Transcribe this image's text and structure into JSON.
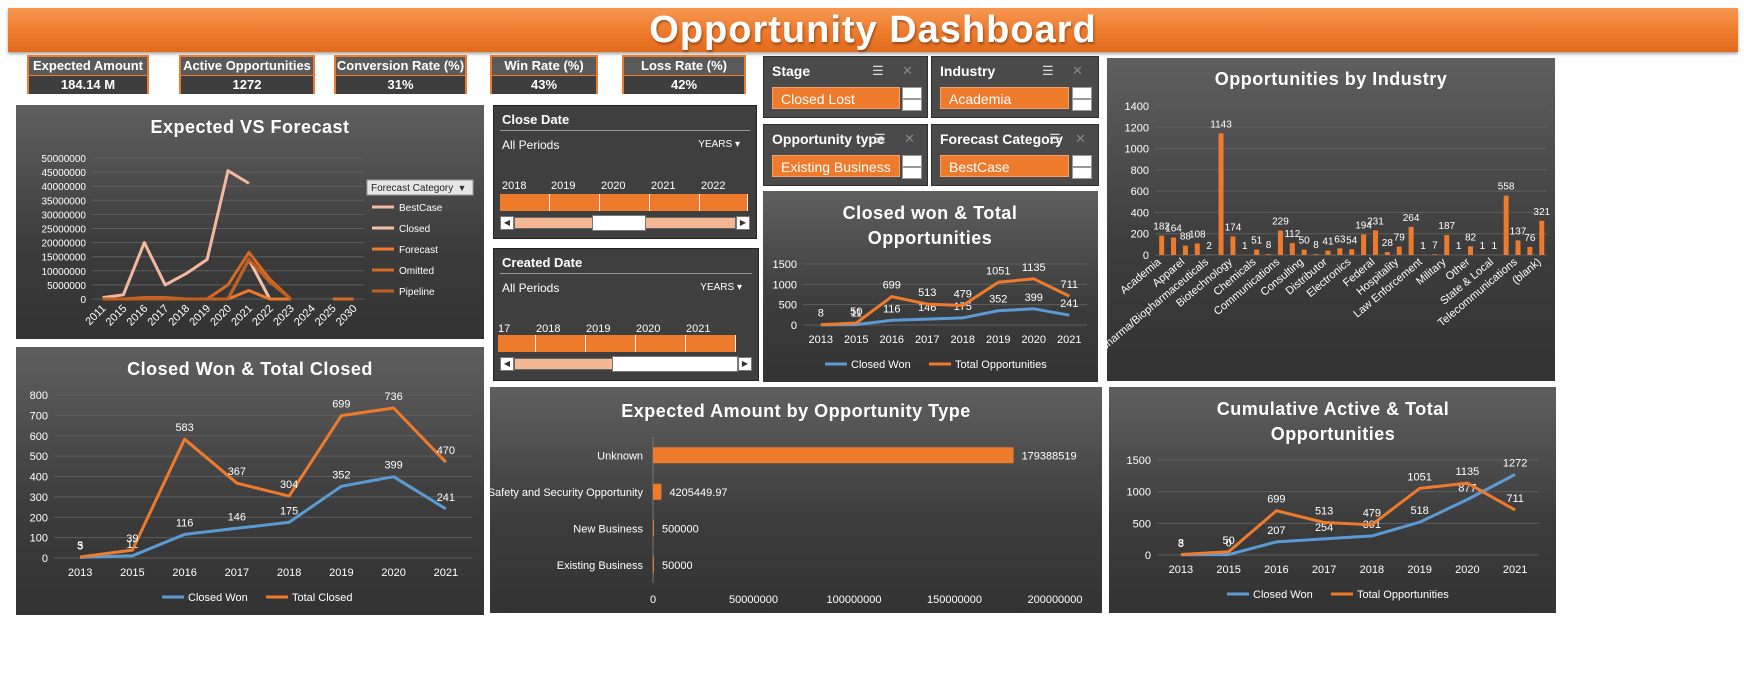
{
  "title": "Opportunity Dashboard",
  "kpis": [
    {
      "label": "Expected Amount",
      "value": "184.14 M"
    },
    {
      "label": "Active Opportunities",
      "value": "1272"
    },
    {
      "label": "Conversion Rate (%)",
      "value": "31%"
    },
    {
      "label": "Win Rate (%)",
      "value": "43%"
    },
    {
      "label": "Loss Rate (%)",
      "value": "42%"
    }
  ],
  "slicers": {
    "stage": {
      "title": "Stage",
      "selected": "Closed Lost"
    },
    "industry": {
      "title": "Industry",
      "selected": "Academia"
    },
    "opp_type": {
      "title": "Opportunity type",
      "selected": "Existing Business"
    },
    "forecast": {
      "title": "Forecast Category",
      "selected": "BestCase"
    }
  },
  "timelines": {
    "close_date": {
      "title": "Close Date",
      "period": "All Periods",
      "level": "YEARS",
      "years": [
        "2018",
        "2019",
        "2020",
        "2021",
        "2022"
      ]
    },
    "created_date": {
      "title": "Created Date",
      "period": "All Periods",
      "level": "YEARS",
      "years": [
        "17",
        "2018",
        "2019",
        "2020",
        "2021"
      ]
    }
  },
  "colors": {
    "orange": "#ee7a2c",
    "blue": "#5b9bd5",
    "accent": "#ee7a2c"
  },
  "chart_data": [
    {
      "id": "expected_vs_forecast",
      "type": "line",
      "title": "Expected VS Forecast",
      "categories": [
        "2011",
        "2015",
        "2016",
        "2017",
        "2018",
        "2019",
        "2020",
        "2021",
        "2022",
        "2023",
        "2024",
        "2025",
        "2030"
      ],
      "ylim": [
        0,
        50000000
      ],
      "yticks": [
        "0",
        "5000000",
        "10000000",
        "15000000",
        "20000000",
        "25000000",
        "30000000",
        "35000000",
        "40000000",
        "45000000",
        "50000000"
      ],
      "legend_title": "Forecast Category",
      "series": [
        {
          "name": "BestCase",
          "color": "#f2b8a0",
          "values": [
            500000,
            1500000,
            20000000,
            5000000,
            9000000,
            14000000,
            45500000,
            41000000,
            null,
            null,
            null,
            null,
            null
          ]
        },
        {
          "name": "Closed",
          "color": "#f4c2a9",
          "values": [
            0,
            0,
            0,
            0,
            0,
            0,
            0,
            14000000,
            0,
            null,
            null,
            null,
            null
          ]
        },
        {
          "name": "Forecast",
          "color": "#ee7a2c",
          "values": [
            0,
            0,
            0,
            0,
            0,
            0,
            0,
            3000000,
            0,
            0,
            null,
            null,
            null
          ]
        },
        {
          "name": "Omitted",
          "color": "#d56a24",
          "values": [
            0,
            0,
            500000,
            500000,
            0,
            0,
            5000000,
            16500000,
            7000000,
            0,
            null,
            0,
            0
          ]
        },
        {
          "name": "Pipeline",
          "color": "#c05f20",
          "values": [
            0,
            0,
            0,
            0,
            0,
            0,
            0,
            14000000,
            6000000,
            0,
            null,
            null,
            null
          ]
        }
      ]
    },
    {
      "id": "closed_won_total_closed",
      "type": "line",
      "title": "Closed Won & Total Closed",
      "categories": [
        "2013",
        "2015",
        "2016",
        "2017",
        "2018",
        "2019",
        "2020",
        "2021"
      ],
      "ylim": [
        0,
        800
      ],
      "yticks": [
        "0",
        "100",
        "200",
        "300",
        "400",
        "500",
        "600",
        "700",
        "800"
      ],
      "series": [
        {
          "name": "Closed Won",
          "color": "#5b9bd5",
          "values": [
            3,
            11,
            116,
            146,
            175,
            352,
            399,
            241
          ],
          "labels": [
            "3",
            "11",
            "116",
            "146",
            "175",
            "352",
            "399",
            "241"
          ]
        },
        {
          "name": "Total Closed",
          "color": "#ee7a2c",
          "values": [
            5,
            39,
            583,
            367,
            304,
            699,
            736,
            470
          ],
          "labels": [
            "5",
            "39",
            "583",
            "367",
            "304",
            "699",
            "736",
            "470"
          ]
        }
      ]
    },
    {
      "id": "closed_won_total_opps",
      "type": "line",
      "title": "Closed won & Total Opportunities",
      "categories": [
        "2013",
        "2015",
        "2016",
        "2017",
        "2018",
        "2019",
        "2020",
        "2021"
      ],
      "ylim": [
        0,
        1500
      ],
      "yticks": [
        "0",
        "500",
        "1000",
        "1500"
      ],
      "series": [
        {
          "name": "Closed Won",
          "color": "#5b9bd5",
          "values": [
            3,
            11,
            116,
            146,
            175,
            352,
            399,
            241
          ],
          "labels": [
            "",
            "11",
            "116",
            "146",
            "175",
            "352",
            "399",
            "241"
          ]
        },
        {
          "name": "Total Opportunities",
          "color": "#ee7a2c",
          "values": [
            8,
            50,
            699,
            513,
            479,
            1051,
            1135,
            711
          ],
          "labels": [
            "8",
            "50",
            "699",
            "513",
            "479",
            "1051",
            "1135",
            "711"
          ]
        }
      ]
    },
    {
      "id": "opps_by_industry",
      "type": "bar",
      "title": "Opportunities by Industry",
      "categories": [
        "Academia",
        "",
        "Apparel",
        "",
        "Biopharma/Biopharmaceuticals",
        "",
        "Biotechnology",
        "",
        "Chemicals",
        "",
        "Communications",
        "",
        "Consulting",
        "",
        "Distributor",
        "",
        "Electronics",
        "",
        "Federal",
        "",
        "Hospitality",
        "",
        "Law Enforcement",
        "",
        "Military",
        "",
        "Other",
        "",
        "State & Local",
        "",
        "Telecommunications",
        "",
        "(blank)"
      ],
      "values": [
        182,
        164,
        88,
        108,
        2,
        1143,
        174,
        1,
        51,
        8,
        229,
        112,
        50,
        8,
        41,
        63,
        54,
        194,
        231,
        28,
        79,
        264,
        1,
        7,
        187,
        1,
        82,
        1,
        1,
        558,
        137,
        76,
        321
      ],
      "ylim": [
        0,
        1400
      ],
      "yticks": [
        "0",
        "200",
        "400",
        "600",
        "800",
        "1000",
        "1200",
        "1400"
      ]
    },
    {
      "id": "expected_by_type",
      "type": "bar",
      "orientation": "horizontal",
      "title": "Expected Amount by Opportunity Type",
      "categories": [
        "Unknown",
        "Safety and Security Opportunity",
        "New Business",
        "Existing Business"
      ],
      "values": [
        179388519,
        4205449.97,
        500000,
        50000
      ],
      "labels": [
        "179388519",
        "4205449.97",
        "500000",
        "50000"
      ],
      "xlim": [
        0,
        200000000
      ],
      "xticks": [
        "0",
        "50000000",
        "100000000",
        "150000000",
        "200000000"
      ]
    },
    {
      "id": "cumulative_active_total",
      "type": "line",
      "title": "Cumulative  Active & Total Opportunities",
      "categories": [
        "2013",
        "2015",
        "2016",
        "2017",
        "2018",
        "2019",
        "2020",
        "2021"
      ],
      "ylim": [
        0,
        1500
      ],
      "yticks": [
        "0",
        "500",
        "1000",
        "1500"
      ],
      "series": [
        {
          "name": "Closed Won",
          "color": "#5b9bd5",
          "values": [
            3,
            7,
            207,
            254,
            301,
            518,
            877,
            1272
          ],
          "labels": [
            "3",
            "0",
            "207",
            "254",
            "301",
            "518",
            "877",
            "1272"
          ]
        },
        {
          "name": "Total Opportunities",
          "color": "#ee7a2c",
          "values": [
            8,
            50,
            699,
            513,
            479,
            1051,
            1135,
            711
          ],
          "labels": [
            "8",
            "50",
            "699",
            "513",
            "479",
            "1051",
            "1135",
            "711"
          ]
        }
      ]
    }
  ]
}
